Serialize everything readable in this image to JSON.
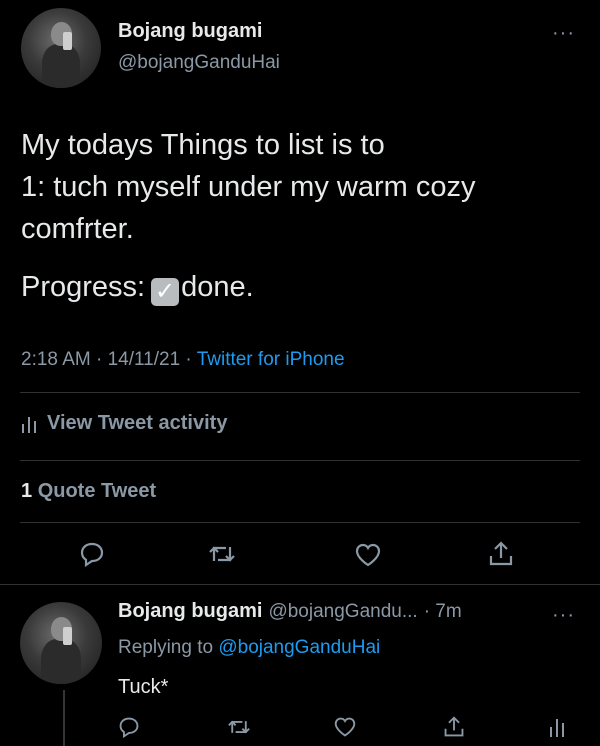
{
  "tweet": {
    "author_name": "Bojang bugami",
    "author_handle": "@bojangGanduHai",
    "more": "···",
    "text_lines": [
      "My todays Things to list is to",
      "1: tuch myself under my warm cozy",
      "comfrter."
    ],
    "progress_label": "Progress:",
    "progress_after": "done.",
    "time": "2:18 AM · 14/11/21 ·",
    "source": "Twitter for iPhone",
    "activity_label": "View Tweet activity",
    "quote_count": "1",
    "quote_label": "Quote Tweet"
  },
  "reply": {
    "author_name": "Bojang bugami",
    "author_handle": "@bojangGandu...",
    "age": "· 7m",
    "more": "···",
    "replying_prefix": "Replying to",
    "replying_handle": "@bojangGanduHai",
    "text": "Tuck*"
  },
  "icons": {
    "reply": "reply-icon",
    "retweet": "retweet-icon",
    "like": "heart-icon",
    "share": "share-icon",
    "analytics": "analytics-icon",
    "checkbox": "check-emoji-icon"
  },
  "colors": {
    "background": "#000000",
    "text": "#e7e9ea",
    "secondary": "#8b98a5",
    "link": "#1d9bf0",
    "divider": "#2f3336"
  }
}
